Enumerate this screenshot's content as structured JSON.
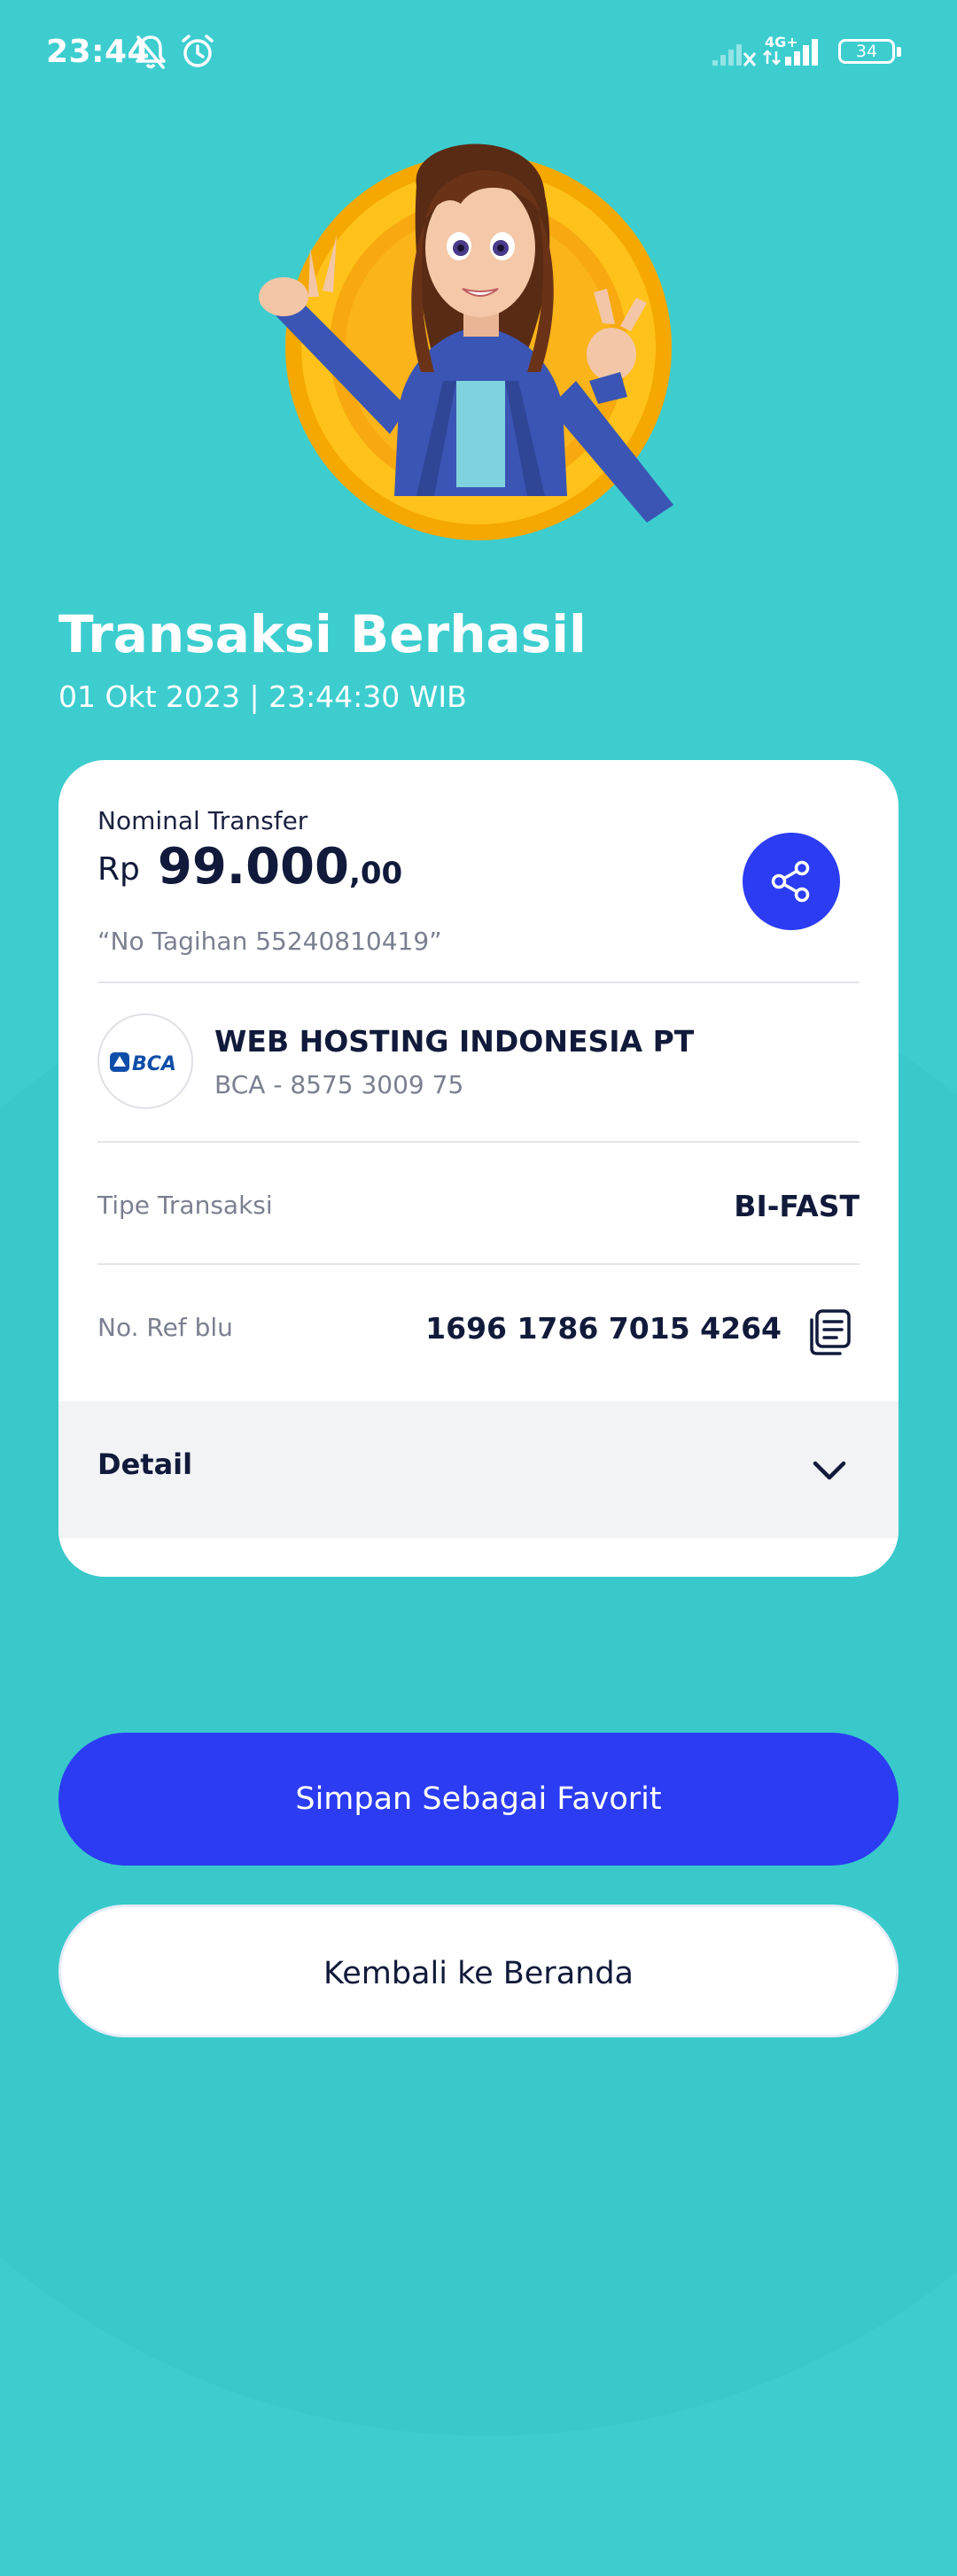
{
  "status_bar": {
    "time": "23:44",
    "network_type": "4G+",
    "battery_level": "34",
    "icons": [
      "mute-bell-icon",
      "alarm-clock-icon",
      "signal-icon",
      "signal-icon",
      "battery-icon"
    ]
  },
  "hero": {
    "illustration": "woman-avatar-peace-sign-coin"
  },
  "header": {
    "title": "Transaksi Berhasil",
    "datetime": "01 Okt 2023  |  23:44:30 WIB"
  },
  "transfer": {
    "amount_label": "Nominal Transfer",
    "currency": "Rp",
    "amount": "99.000",
    "cents": ",00",
    "note": "“No Tagihan 55240810419”",
    "share_icon": "share-icon"
  },
  "recipient": {
    "bank_logo_text": "BCA",
    "name": "WEB HOSTING INDONESIA PT",
    "account": "BCA - 8575 3009 75"
  },
  "details": {
    "transaction_type_label": "Tipe Transaksi",
    "transaction_type_value": "BI-FAST",
    "ref_label": "No. Ref blu",
    "ref_value": "1696 1786 7015 4264",
    "copy_icon": "copy-icon"
  },
  "detail_section": {
    "label": "Detail",
    "icon": "chevron-down-icon"
  },
  "buttons": {
    "save_favorite": "Simpan Sebagai Favorit",
    "back_home": "Kembali ke Beranda"
  },
  "colors": {
    "background": "#3dcdcf",
    "primary": "#2b3cf3",
    "text_dark": "#111a3a",
    "text_muted": "#7b8090",
    "coin_gold": "#f7b800"
  }
}
